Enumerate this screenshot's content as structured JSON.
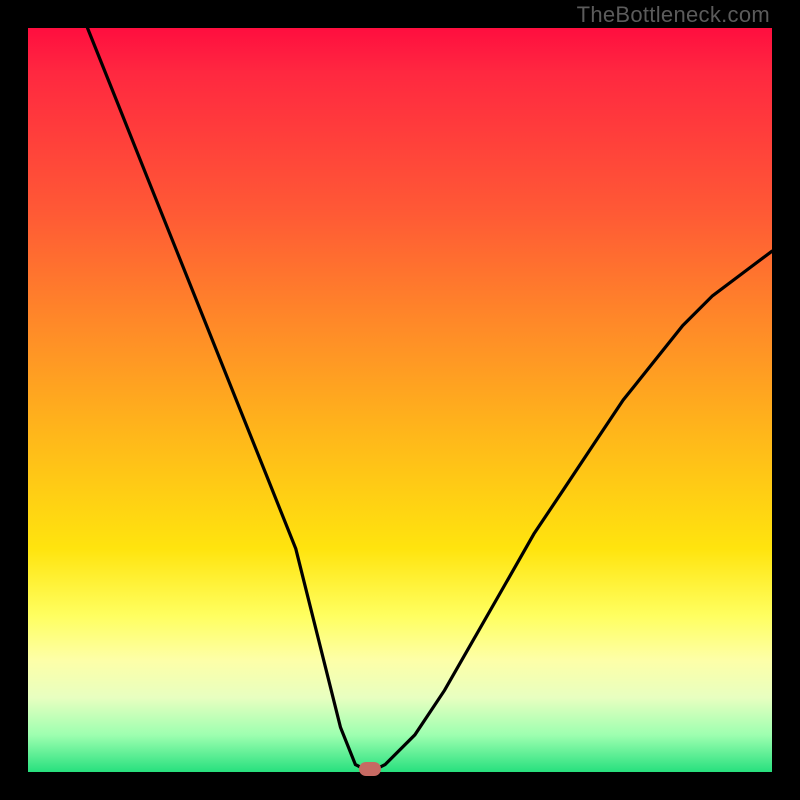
{
  "watermark": "TheBottleneck.com",
  "colors": {
    "frame_bg": "#000000",
    "gradient_top": "#ff0e3f",
    "gradient_mid": "#ffe40e",
    "gradient_bottom": "#27e07e",
    "curve": "#000000",
    "marker": "#c76a63"
  },
  "chart_data": {
    "type": "line",
    "title": "",
    "xlabel": "",
    "ylabel": "",
    "xlim": [
      0,
      100
    ],
    "ylim": [
      0,
      100
    ],
    "grid": false,
    "legend": false,
    "notes": "V-shaped bottleneck curve; minimum near x≈45 where y≈0. Left branch starts near top-left (x≈8, y≈100) and descends steeply. Right branch rises to about y≈70 at x≈100. Marker dot sits at the trough.",
    "series": [
      {
        "name": "bottleneck-curve",
        "x": [
          8,
          12,
          16,
          20,
          24,
          28,
          32,
          36,
          40,
          42,
          44,
          46,
          48,
          52,
          56,
          60,
          64,
          68,
          72,
          76,
          80,
          84,
          88,
          92,
          96,
          100
        ],
        "y": [
          100,
          90,
          80,
          70,
          60,
          50,
          40,
          30,
          14,
          6,
          1,
          0,
          1,
          5,
          11,
          18,
          25,
          32,
          38,
          44,
          50,
          55,
          60,
          64,
          67,
          70
        ]
      }
    ],
    "marker": {
      "x": 46,
      "y": 0
    }
  }
}
